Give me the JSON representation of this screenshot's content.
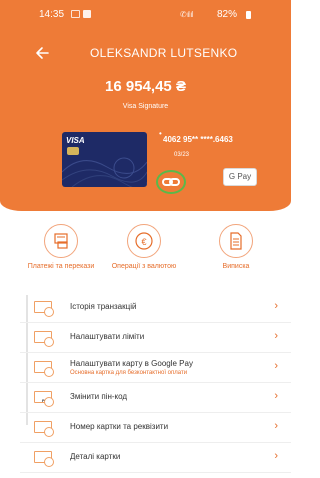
{
  "status_bar": {
    "time": "14:35",
    "battery": "82%"
  },
  "header": {
    "holder_name": "OLEKSANDR LUTSENKO",
    "balance": "16 954,45 ₴",
    "card_type": "Visa Signature",
    "card_number": "4062 95** ****.6463",
    "card_expiry": "03/23",
    "gpay_label": "G Pay",
    "card_brand": "VISA"
  },
  "actions": [
    {
      "label": "Платежі та перекази",
      "icon": "payments-icon"
    },
    {
      "label": "Операції з валютою",
      "icon": "currency-icon"
    },
    {
      "label": "Виписка",
      "icon": "statement-icon"
    }
  ],
  "menu": [
    {
      "label": "Історія транзакцій",
      "sub": ""
    },
    {
      "label": "Налаштувати ліміти",
      "sub": ""
    },
    {
      "label": "Налаштувати карту в Google Pay",
      "sub": "Основна картка для безконтактної оплати"
    },
    {
      "label": "Змінити пін-код",
      "sub": "",
      "icon_text": "PIN"
    },
    {
      "label": "Номер картки та реквізити",
      "sub": ""
    },
    {
      "label": "Деталі картки",
      "sub": ""
    }
  ],
  "colors": {
    "accent": "#ee7b37",
    "link_ring": "#5bb84a"
  }
}
